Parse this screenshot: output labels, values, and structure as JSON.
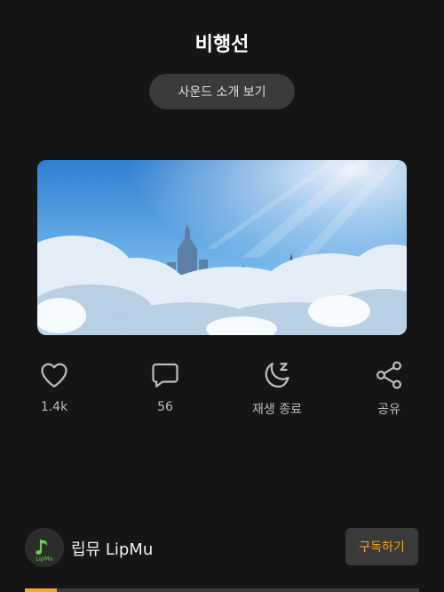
{
  "title": "비행선",
  "intro_button": "사운드 소개 보기",
  "actions": [
    {
      "icon": "heart-icon",
      "label": "1.4k"
    },
    {
      "icon": "comment-icon",
      "label": "56"
    },
    {
      "icon": "sleep-timer-icon",
      "label": "재생 종료"
    },
    {
      "icon": "share-icon",
      "label": "공유"
    }
  ],
  "channel": {
    "name": "립뮤 LipMu",
    "avatar_text": "LipMu",
    "subscribe_label": "구독하기"
  },
  "progress": 0.08,
  "colors": {
    "background": "#151515",
    "accent": "#f5a524",
    "button_bg": "#3a3a3a",
    "logo_green": "#5fd34a"
  }
}
